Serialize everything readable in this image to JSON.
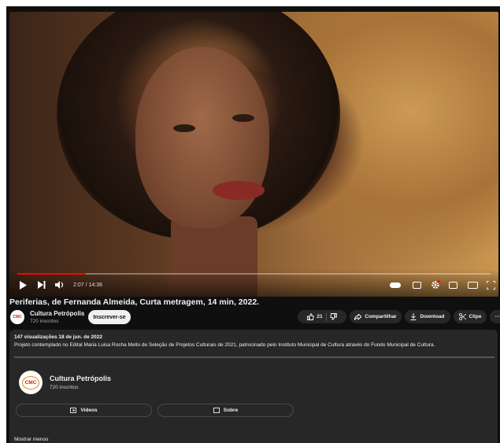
{
  "player": {
    "time": "2:07 / 14:36",
    "progress_fraction": 0.145,
    "icons": [
      "play-icon",
      "next-icon",
      "volume-icon",
      "autoplay-toggle-icon",
      "subtitles-icon",
      "settings-icon",
      "miniplayer-icon",
      "theater-icon",
      "fullscreen-icon"
    ]
  },
  "video": {
    "title": "Periferias, de Fernanda Almeida, Curta metragem, 14 min, 2022."
  },
  "channel": {
    "name": "Cultura Petrópolis",
    "subscribers": "720 inscritos",
    "avatar_text": "CMC",
    "subscribe_label": "Inscrever-se"
  },
  "actions": {
    "likes": "21",
    "share_label": "Compartilhar",
    "download_label": "Download",
    "clip_label": "Clipe",
    "more_label": "···"
  },
  "description": {
    "meta": "147 visualizações  18 de jun. de 2022",
    "text": "Projeto contemplado no Edital Maria Luisa Rocha Mello de Seleção de Projetos Culturais de 2021, patrocinado pelo Instituto Municipal de Cultura através do Fundo Municipal de Cultura.",
    "channel_name": "Cultura Petrópolis",
    "channel_subs": "720 inscritos",
    "videos_label": "Vídeos",
    "about_label": "Sobre",
    "show_less": "Mostrar menos"
  },
  "colors": {
    "background": "#0f0f0f",
    "surface": "#272727",
    "progress": "#ff0000",
    "text": "#f1f1f1"
  }
}
